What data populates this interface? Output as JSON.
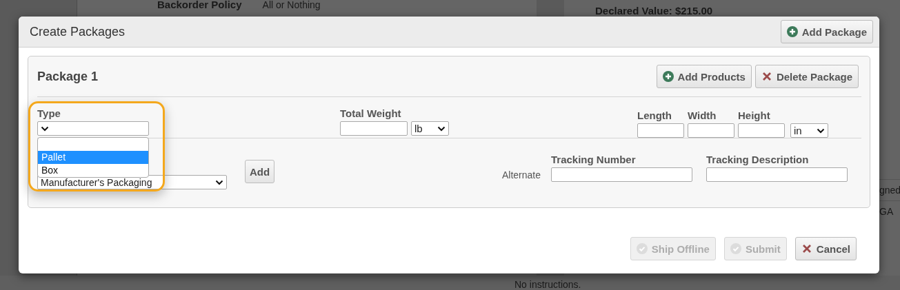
{
  "background": {
    "backorder_label": "Backorder Policy",
    "backorder_value": "All or Nothing",
    "declared_value": "Declared Value: $215.00",
    "column_cut_1": "gned",
    "column_cut_2": "GA",
    "instructions": "No instructions."
  },
  "dialog": {
    "title": "Create Packages",
    "add_package_button": {
      "label": "Add Package",
      "kind": "plus",
      "disabled": false
    }
  },
  "package": {
    "title": "Package 1",
    "buttons": [
      {
        "label": "Add Products",
        "kind": "plus",
        "disabled": false
      },
      {
        "label": "Delete Package",
        "kind": "x",
        "disabled": false
      }
    ],
    "type_field": {
      "label": "Type",
      "open": true,
      "highlighted": true,
      "options": [
        {
          "selected": false
        },
        {
          "label": "Pallet",
          "selected": true
        },
        {
          "label": "Box",
          "selected": false
        }
      ]
    },
    "total_weight": {
      "label": "Total Weight",
      "unit": "lb"
    },
    "dimensions": {
      "labels": [
        "Length",
        "Width",
        "Height"
      ],
      "unit": "in"
    },
    "packaging": {
      "value": "Manufacturer's Packaging",
      "add_button": "Add"
    },
    "alternate_label": "Alternate",
    "tracking_number": {
      "label": "Tracking Number"
    },
    "tracking_description": {
      "label": "Tracking Description"
    }
  },
  "footer_buttons": [
    {
      "label": "Ship Offline",
      "kind": "check",
      "disabled": true
    },
    {
      "label": "Submit",
      "kind": "check",
      "disabled": true
    },
    {
      "label": "Cancel",
      "kind": "x",
      "disabled": false
    }
  ]
}
